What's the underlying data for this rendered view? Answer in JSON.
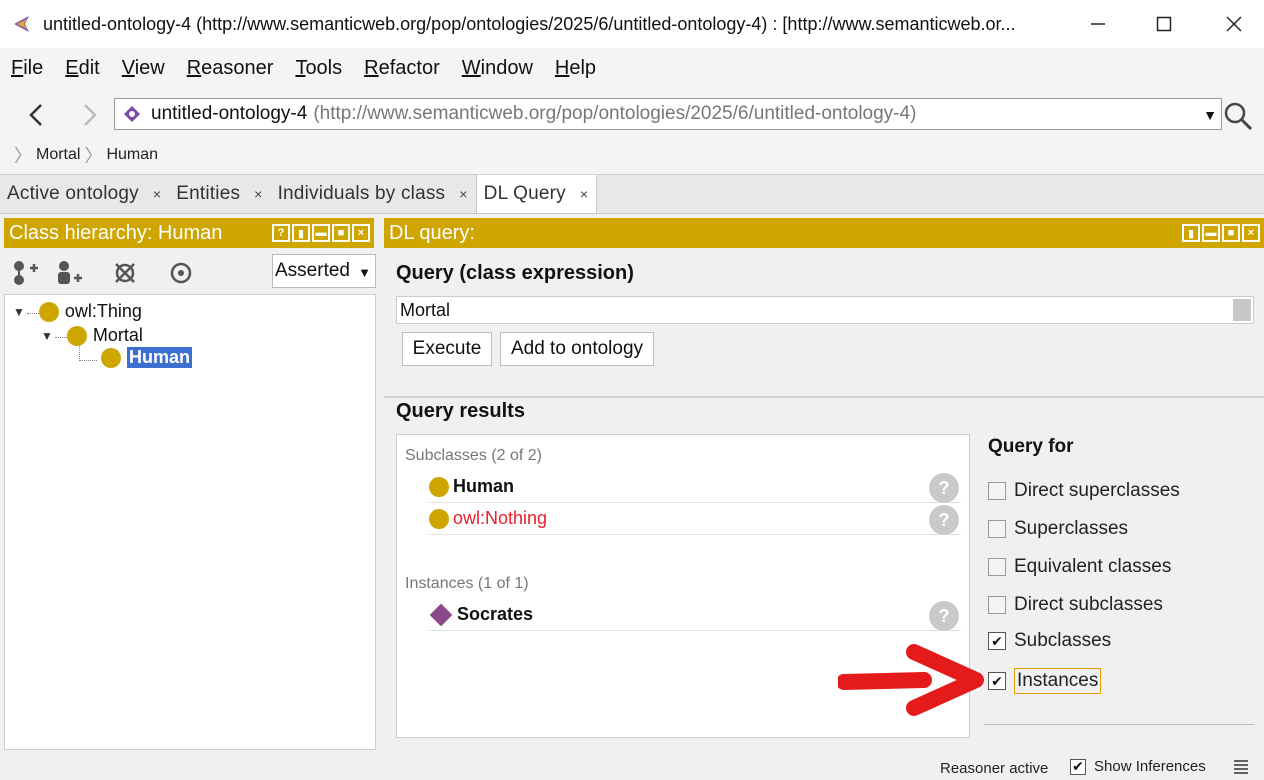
{
  "window": {
    "title": "untitled-ontology-4 (http://www.semanticweb.org/pop/ontologies/2025/6/untitled-ontology-4)  : [http://www.semanticweb.or..."
  },
  "menu": [
    {
      "label": "File",
      "key": "F",
      "rest": "ile"
    },
    {
      "label": "Edit",
      "key": "E",
      "rest": "dit"
    },
    {
      "label": "View",
      "key": "V",
      "rest": "iew"
    },
    {
      "label": "Reasoner",
      "key": "R",
      "rest": "easoner"
    },
    {
      "label": "Tools",
      "key": "T",
      "rest": "ools"
    },
    {
      "label": "Refactor",
      "key": "R",
      "rest": "efactor"
    },
    {
      "label": "Window",
      "key": "W",
      "rest": "indow"
    },
    {
      "label": "Help",
      "key": "H",
      "rest": "elp"
    }
  ],
  "nav": {
    "ontology_name": "untitled-ontology-4",
    "ontology_iri": "(http://www.semanticweb.org/pop/ontologies/2025/6/untitled-ontology-4)",
    "breadcrumb": [
      "Mortal",
      "Human"
    ]
  },
  "tabs": [
    "Active ontology",
    "Entities",
    "Individuals by class",
    "DL Query"
  ],
  "class_hierarchy": {
    "header": "Class hierarchy: Human",
    "mode": "Asserted",
    "nodes": [
      "owl:Thing",
      "Mortal",
      "Human"
    ]
  },
  "dl_query": {
    "header": "DL query:",
    "query_title": "Query (class expression)",
    "query_value": "Mortal",
    "execute_label": "Execute",
    "add_label": "Add to ontology",
    "results_title": "Query results",
    "subclasses_group": "Subclasses (2 of 2)",
    "subclasses": [
      "Human",
      "owl:Nothing"
    ],
    "instances_group": "Instances (1 of 1)",
    "instances": [
      "Socrates"
    ],
    "help_glyph": "?"
  },
  "query_for": {
    "title": "Query for",
    "options": [
      {
        "label": "Direct superclasses",
        "checked": false
      },
      {
        "label": "Superclasses",
        "checked": false
      },
      {
        "label": "Equivalent classes",
        "checked": false
      },
      {
        "label": "Direct subclasses",
        "checked": false
      },
      {
        "label": "Subclasses",
        "checked": true
      },
      {
        "label": "Instances",
        "checked": true
      }
    ]
  },
  "status": {
    "reasoner": "Reasoner active",
    "show_inferences": "Show Inferences"
  },
  "colors": {
    "header_gold": "#cfa500",
    "selection_blue": "#3c6fd0",
    "nothing_red": "#e8202a",
    "annotation_arrow": "#e51b1b"
  }
}
